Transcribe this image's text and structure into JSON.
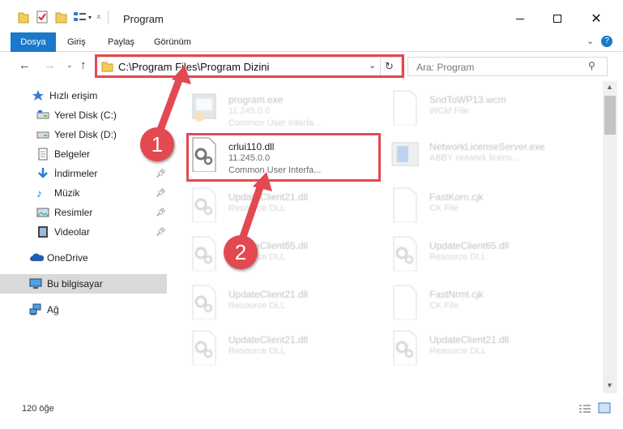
{
  "window": {
    "title": "Program",
    "controls": [
      "minimize-icon",
      "maximize-icon",
      "close-icon"
    ]
  },
  "ribbon": {
    "tabs": [
      "Dosya",
      "Giriş",
      "Paylaş",
      "Görünüm"
    ],
    "expand_icon": "chevron-down-icon",
    "help_icon": "help-icon"
  },
  "address": {
    "path": "C:\\Program Files\\Program Dizini",
    "search_placeholder": "Ara: Program"
  },
  "sidebar": {
    "items": [
      {
        "label": "Hızlı erişim",
        "icon": "star-icon",
        "pinned": false
      },
      {
        "label": "Yerel Disk (C:)",
        "icon": "drive-icon",
        "pinned": false
      },
      {
        "label": "Yerel Disk (D:)",
        "icon": "drive-icon",
        "pinned": false
      },
      {
        "label": "Belgeler",
        "icon": "document-icon",
        "pinned": false
      },
      {
        "label": "İndirmeler",
        "icon": "download-icon",
        "pinned": true
      },
      {
        "label": "Müzik",
        "icon": "music-icon",
        "pinned": true
      },
      {
        "label": "Resimler",
        "icon": "image-icon",
        "pinned": true
      },
      {
        "label": "Videolar",
        "icon": "video-icon",
        "pinned": true
      },
      {
        "label": "OneDrive",
        "icon": "cloud-icon",
        "pinned": false
      },
      {
        "label": "Bu bilgisayar",
        "icon": "computer-icon",
        "pinned": false,
        "selected": true
      },
      {
        "label": "Ağ",
        "icon": "network-icon",
        "pinned": false
      }
    ]
  },
  "files": [
    {
      "name": "program.exe",
      "line2": "11.245.0.0",
      "line3": "Common User Interfa...",
      "icon": "exe-icon",
      "faded": true
    },
    {
      "name": "SndToWP13.wcm",
      "line2": "WCM File",
      "line3": "",
      "icon": "blank-file-icon",
      "faded": true
    },
    {
      "name": "crlui110.dll",
      "line2": "11.245.0.0",
      "line3": "Common User Interfa...",
      "icon": "dll-gear-icon",
      "faded": false,
      "highlighted": true
    },
    {
      "name": "NetworkLicenseServer.exe",
      "line2": "ABBY network licens...",
      "line3": "",
      "icon": "server-icon",
      "faded": true
    },
    {
      "name": "UpdateClient21.dll",
      "line2": "Resource DLL",
      "line3": "",
      "icon": "dll-gear-icon",
      "faded": true
    },
    {
      "name": "FastKorn.cjk",
      "line2": "CK File",
      "line3": "",
      "icon": "blank-file-icon",
      "faded": true
    },
    {
      "name": "UpdateClient65.dll",
      "line2": "Resource DLL",
      "line3": "",
      "icon": "dll-gear-icon",
      "faded": true
    },
    {
      "name": "UpdateClient65.dll",
      "line2": "Resource DLL",
      "line3": "",
      "icon": "dll-gear-icon",
      "faded": true
    },
    {
      "name": "UpdateClient21.dll",
      "line2": "Resource DLL",
      "line3": "",
      "icon": "dll-gear-icon",
      "faded": true
    },
    {
      "name": "FastNrml.cjk",
      "line2": "CK File",
      "line3": "",
      "icon": "blank-file-icon",
      "faded": true
    },
    {
      "name": "UpdateClient21.dll",
      "line2": "Resource DLL",
      "line3": "",
      "icon": "dll-gear-icon",
      "faded": true
    },
    {
      "name": "UpdateClient21.dll",
      "line2": "Resource DLL",
      "line3": "",
      "icon": "dll-gear-icon",
      "faded": true
    }
  ],
  "status": {
    "item_count": "120 öğe"
  },
  "annotations": {
    "markers": [
      "1",
      "2"
    ],
    "color": "#e34950"
  },
  "colors": {
    "accent": "#1979ca",
    "selection": "#d9d9d9"
  }
}
